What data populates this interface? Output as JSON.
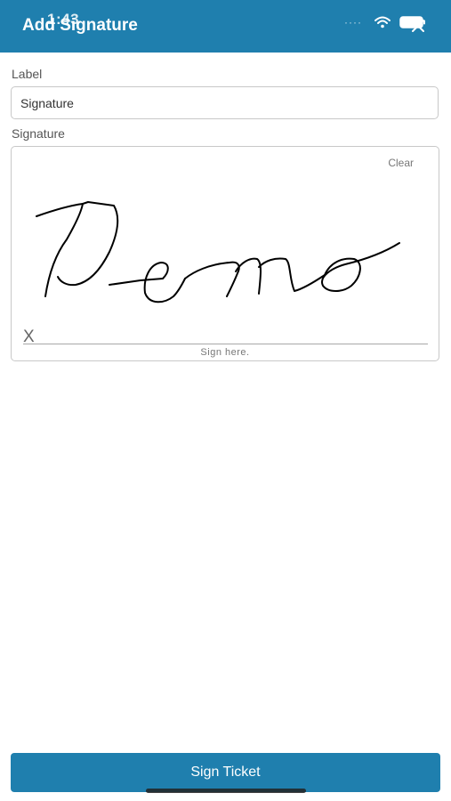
{
  "status_bar": {
    "time": "1:43"
  },
  "header": {
    "title": "Add Signature",
    "close_icon": "close-icon"
  },
  "form": {
    "label_field": {
      "label": "Label",
      "value": "Signature"
    },
    "signature_field": {
      "label": "Signature",
      "clear_label": "Clear",
      "x_mark": "X",
      "hint": "Sign here.",
      "signature_text": "Demo"
    }
  },
  "footer": {
    "primary_button_label": "Sign Ticket"
  },
  "colors": {
    "accent": "#1f7fae",
    "background": "#ffffff"
  }
}
